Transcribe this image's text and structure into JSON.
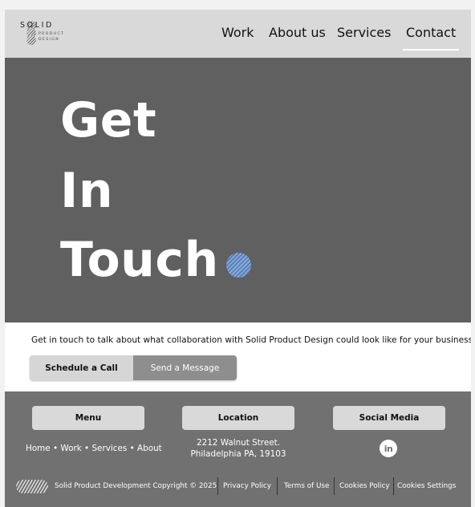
{
  "header": {
    "logo_line1": "SOLID",
    "logo_line2": "PRODUCT",
    "logo_line3": "DESIGN",
    "nav": [
      "Work",
      "About us",
      "Services",
      "Contact"
    ],
    "active_nav": "Contact"
  },
  "hero": {
    "words": [
      "Get",
      "In",
      "Touch"
    ],
    "dot_color": "#5a7fb8"
  },
  "intro": {
    "text": "Get in touch to talk about what collaboration with Solid Product Design could look like for your business.",
    "schedule_label": "Schedule a Call",
    "message_label": "Send a Message"
  },
  "footer": {
    "menu_label": "Menu",
    "location_label": "Location",
    "social_label": "Social Media",
    "menu_links": "Home • Work • Services • About",
    "address_line1": "2212 Walnut Street.",
    "address_line2": "Philadelphia PA, 19103",
    "linkedin_icon": "in",
    "copyright": "Solid Product Development Copyright © 2025.",
    "privacy": "Privacy Policy",
    "terms": "Terms of Use",
    "cookies_policy": "Cookies Policy",
    "cookies_settings": "Cookies Settings"
  },
  "colors": {
    "header_bg": "#d9d9d9",
    "hero_bg": "#606060",
    "footer_bg": "#717171",
    "accent": "#5a7fb8"
  }
}
